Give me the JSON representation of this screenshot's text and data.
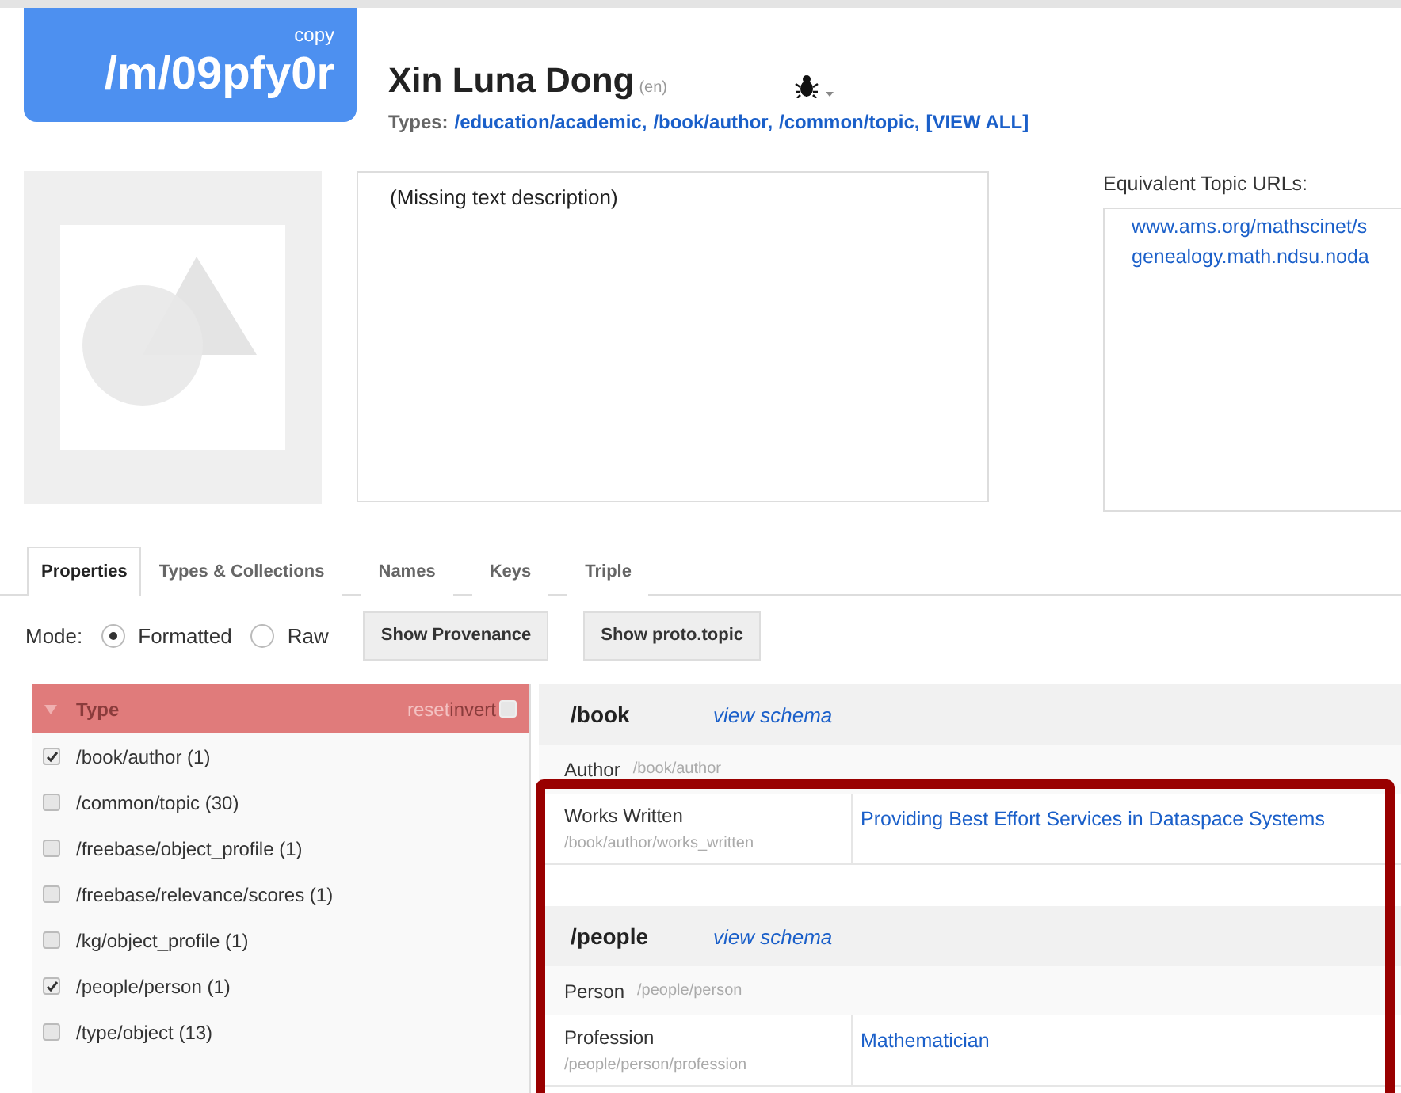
{
  "entity": {
    "id": "/m/09pfy0r",
    "copy_label": "copy",
    "name": "Xin Luna Dong",
    "lang": "(en)",
    "types_label": "Types:",
    "types": [
      "/education/academic,",
      "/book/author,",
      "/common/topic,",
      "[VIEW ALL]"
    ]
  },
  "description": "(Missing text description)",
  "equivalent": {
    "label": "Equivalent Topic URLs:",
    "urls": [
      "www.ams.org/mathscinet/s",
      "genealogy.math.ndsu.noda"
    ]
  },
  "tabs": [
    {
      "label": "Properties",
      "selected": true
    },
    {
      "label": "Types & Collections",
      "selected": false
    },
    {
      "label": "Names",
      "selected": false
    },
    {
      "label": "Keys",
      "selected": false
    },
    {
      "label": "Triple",
      "selected": false
    }
  ],
  "mode": {
    "label": "Mode:",
    "options": [
      {
        "label": "Formatted",
        "selected": true
      },
      {
        "label": "Raw",
        "selected": false
      }
    ]
  },
  "buttons": [
    "Show Provenance",
    "Show proto.topic"
  ],
  "filter": {
    "title": "Type",
    "reset": "reset",
    "invert": "invert",
    "invert_checked": false,
    "items": [
      {
        "label": "/book/author (1)",
        "checked": true
      },
      {
        "label": "/common/topic (30)",
        "checked": false
      },
      {
        "label": "/freebase/object_profile (1)",
        "checked": false
      },
      {
        "label": "/freebase/relevance/scores (1)",
        "checked": false
      },
      {
        "label": "/kg/object_profile (1)",
        "checked": false
      },
      {
        "label": "/people/person (1)",
        "checked": true
      },
      {
        "label": "/type/object (13)",
        "checked": false
      }
    ]
  },
  "domains": [
    {
      "name": "/book",
      "schema_link": "view schema",
      "rows": [
        {
          "kind": "type",
          "label": "Author",
          "path": "/book/author"
        },
        {
          "kind": "property",
          "label": "Works Written",
          "path": "/book/author/works_written",
          "value": "Providing Best Effort Services in Dataspace Systems"
        }
      ]
    },
    {
      "name": "/people",
      "schema_link": "view schema",
      "rows": [
        {
          "kind": "type",
          "label": "Person",
          "path": "/people/person"
        },
        {
          "kind": "property",
          "label": "Profession",
          "path": "/people/person/profession",
          "value": "Mathematician"
        }
      ]
    }
  ]
}
